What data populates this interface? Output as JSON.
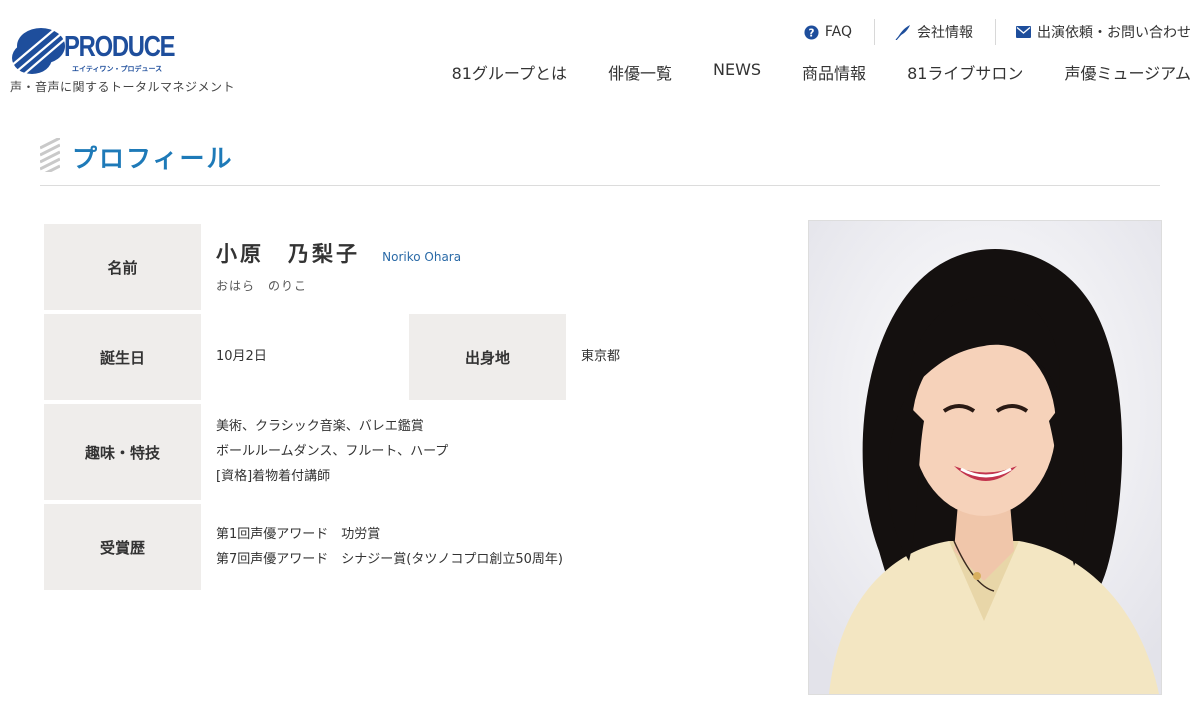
{
  "logo": {
    "word": "PRODUCE",
    "kana": "エイティワン・プロデュース",
    "tagline": "声・音声に関するトータルマネジメント",
    "brand_color": "#1e4e9c"
  },
  "util_nav": [
    {
      "label": "FAQ",
      "icon": "question-circle-icon"
    },
    {
      "label": "会社情報",
      "icon": "quill-icon"
    },
    {
      "label": "出演依頼・お問い合わせ",
      "icon": "envelope-icon"
    }
  ],
  "main_nav": [
    "81グループとは",
    "俳優一覧",
    "NEWS",
    "商品情報",
    "81ライブサロン",
    "声優ミュージアム"
  ],
  "section": {
    "title": "プロフィール",
    "title_color": "#1e7ab8"
  },
  "profile": {
    "name_label": "名前",
    "name": "小原　乃梨子",
    "name_en": "Noriko Ohara",
    "name_kana": "おはら　のりこ",
    "birthday_label": "誕生日",
    "birthday": "10月2日",
    "birthplace_label": "出身地",
    "birthplace": "東京都",
    "hobby_label": "趣味・特技",
    "hobbies": [
      "美術、クラシック音楽、バレエ鑑賞",
      "ボールルームダンス、フルート、ハープ",
      "[資格]着物着付講師"
    ],
    "awards_label": "受賞歴",
    "awards": [
      "第1回声優アワード　功労賞",
      "第7回声優アワード　シナジー賞(タツノコプロ創立50周年)"
    ],
    "label_bg": "#efedeb"
  },
  "photo": {
    "icon": "portrait-photo"
  }
}
